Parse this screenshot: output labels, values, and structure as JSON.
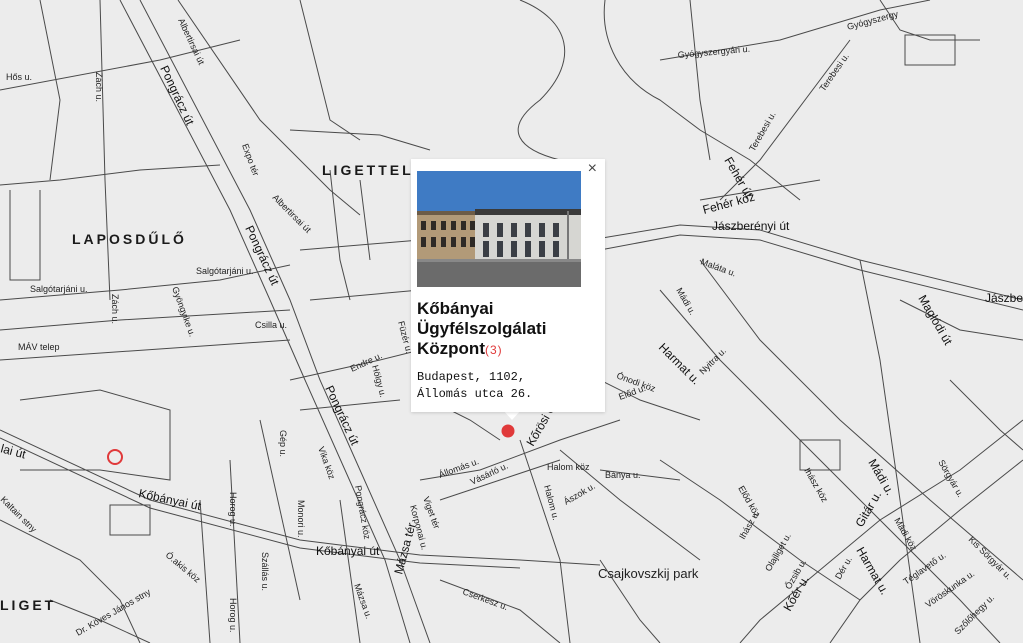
{
  "districts": [
    "LIGETTELEK",
    "LAPOSDŰLŐ",
    "LIGET"
  ],
  "streets": {
    "albertirsai": "Albertirsai út",
    "pongracz": "Pongrácz út",
    "hos": "Hős u.",
    "zach": "Zách u.",
    "expo": "Expo tér",
    "salgotarjani": "Salgótarjáni u.",
    "gyongyike": "Gyöngyike u.",
    "csilla": "Csilla u.",
    "mav": "MÁV telep",
    "kobanyai": "Kőbányai út",
    "horog": "Horog u.",
    "gep": "Gép u.",
    "vika": "Vika köz",
    "monori": "Monori u.",
    "pongracz_koz": "Pongrácz köz",
    "szallas": "Szállás u.",
    "mazsa": "Mázsa u.",
    "mazsa_ter": "Mázsa tér",
    "korponai": "Korponai u.",
    "viget": "Viget tér",
    "cserkesz": "Cserkesz u.",
    "allomas": "Állomás u.",
    "vasarlo": "Vásárló u.",
    "korosi": "Kőrösi Cs.",
    "halom": "Halom u.",
    "halom_koz": "Halom köz",
    "aszok": "Ászok u.",
    "banya": "Bánya u.",
    "harmat": "Harmat u.",
    "nyitra": "Nyitra u.",
    "onodi": "Ónodi köz",
    "elod": "Előd u.",
    "madi": "Mádi u.",
    "malata": "Maláta u.",
    "jaszberenyi": "Jászberényi út",
    "jaszbe": "Jászbe",
    "magladi": "Maglódi út",
    "feher_koz": "Fehér köz",
    "feher": "Fehér út",
    "gyogyszergyari": "Gyógyszergyári u.",
    "gyogyszergy": "Gyógyszergy",
    "terebesi": "Terebesi u.",
    "endre": "Endre u.",
    "hoigy": "Hölgy u.",
    "fuzer": "Füzér u.",
    "ihasz_koz": "Ihász köz",
    "ihasz": "Ihász u.",
    "elod_koz": "Előd köz",
    "gitar": "Gitár u.",
    "madi_koz": "Mádi köz",
    "sorgyar": "Sörgyár u.",
    "kis_sorgyar": "Kis Sörgyár u.",
    "teglaveto": "Téglavető u.",
    "voroskunka": "Vöröskunka u.",
    "szolohegy": "Szőlőhegy u.",
    "olajliget": "Olajliget u.",
    "ozsib": "Őzsib u.",
    "der": "Dér u.",
    "koer": "Kőér u.",
    "oakis": "Ó.akis köz",
    "koves": "Dr. Köves János stny",
    "kaltain": "Kaltain stny",
    "lai": "lai út",
    "park": "Csajkovszkij park",
    "liget_top": "LIGETTEL"
  },
  "popup": {
    "title": "Kőbányai Ügyfélszolgálati Központ",
    "count": "(3)",
    "address_line1": "Budapest, 1102,",
    "address_line2": "Állomás utca 26.",
    "close": "×"
  },
  "colors": {
    "map_bg": "#ececec",
    "road": "#4a4a4a",
    "marker": "#e0393a"
  }
}
